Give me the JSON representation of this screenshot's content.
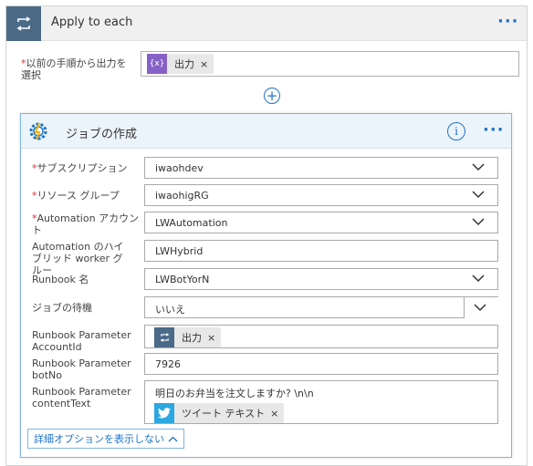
{
  "loop": {
    "title": "Apply to each",
    "prev_label": "以前の手順から出力を選択",
    "prev_token": "出力",
    "token_icon": "{x}"
  },
  "job": {
    "title": "ジョブの作成",
    "fields": {
      "subscription": {
        "label": "サブスクリプション",
        "value": "iwaohdev",
        "required": true
      },
      "resource_group": {
        "label": "リソース グループ",
        "value": "iwaohigRG",
        "required": true
      },
      "automation_account": {
        "label": "Automation アカウント",
        "value": "LWAutomation",
        "required": true
      },
      "hybrid_worker": {
        "label": "Automation のハイブリッド worker グルー",
        "value": "LWHybrid"
      },
      "runbook": {
        "label": "Runbook 名",
        "value": "LWBotYorN"
      },
      "wait": {
        "label": "ジョブの待機",
        "value": "いいえ"
      },
      "param_account": {
        "label": "Runbook Parameter AccountId",
        "token": "出力"
      },
      "param_botno": {
        "label": "Runbook Parameter botNo",
        "value": "7926"
      },
      "param_content": {
        "label": "Runbook Parameter contentText",
        "value": "明日のお弁当を注文しますか? \\n\\n",
        "token": "ツイート テキスト"
      }
    },
    "advanced_toggle": "詳細オプションを表示しない"
  },
  "colors": {
    "accent": "#1e73c8",
    "required": "#d13438",
    "loop_icon_bg": "#4b6a88",
    "expr_token": "#8661c5",
    "twitter": "#2da7e0"
  }
}
